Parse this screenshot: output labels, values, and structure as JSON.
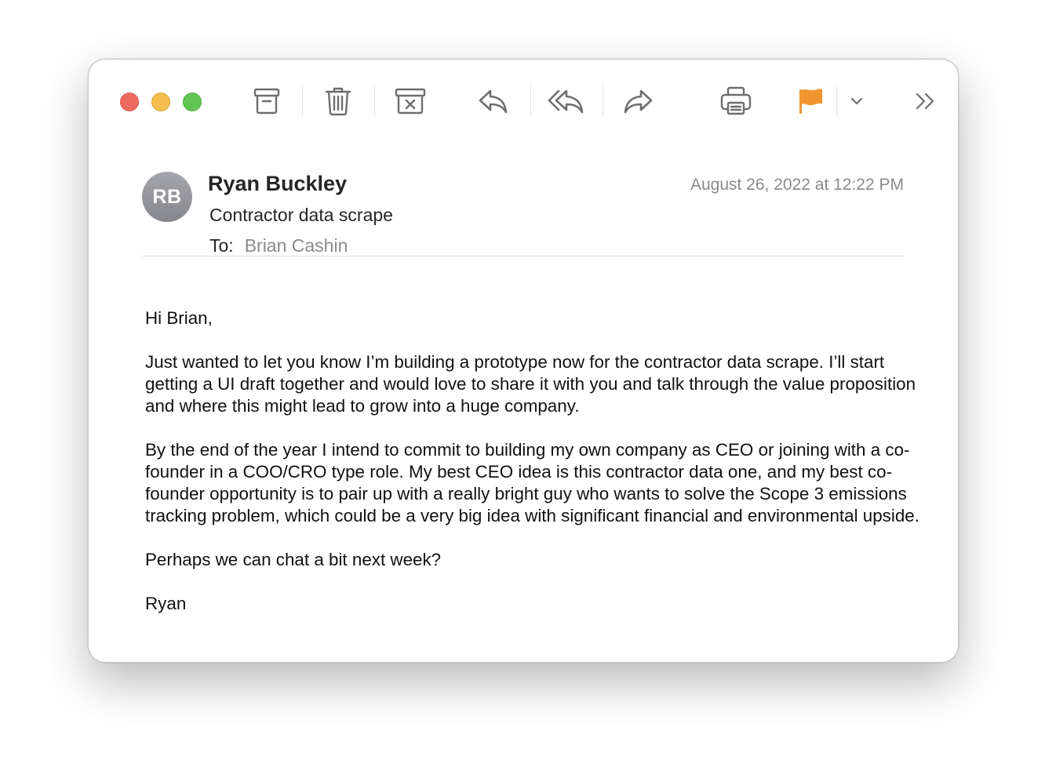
{
  "window": {
    "traffic_lights": [
      "close",
      "minimize",
      "zoom"
    ]
  },
  "toolbar": {
    "buttons": [
      {
        "icon": "archive-icon"
      },
      {
        "icon": "trash-icon"
      },
      {
        "icon": "junk-icon"
      },
      {
        "icon": "reply-icon"
      },
      {
        "icon": "reply-all-icon"
      },
      {
        "icon": "forward-icon"
      },
      {
        "icon": "print-icon"
      },
      {
        "icon": "flag-icon",
        "color": "#f0952f"
      },
      {
        "icon": "chevron-down-icon"
      },
      {
        "icon": "more-icon"
      }
    ]
  },
  "message": {
    "avatar_initials": "RB",
    "sender": "Ryan Buckley",
    "subject": "Contractor data scrape",
    "to_label": "To:",
    "to": "Brian Cashin",
    "date": "August 26, 2022 at 12:22 PM",
    "body": [
      "Hi Brian,",
      "Just wanted to let you know I’m building a prototype now for the contractor data scrape. I’ll start getting a UI draft together and would love to share it with you and talk through the value proposition and where this might lead to grow into a huge company.",
      "By the end of the year I intend to commit to building my own company as CEO or joining with a co-founder in a COO/CRO type role. My best CEO idea is this contractor data one, and my best co-founder opportunity is to pair up with a really bright guy who wants to solve the Scope 3 emissions tracking problem, which could be a very big idea with significant financial and environmental upside.",
      "Perhaps we can chat a bit next week?",
      "Ryan"
    ]
  },
  "colors": {
    "close": "#ec6a5e",
    "minimize": "#f4bf4f",
    "zoom": "#61c554",
    "flag": "#f0952f",
    "icon_gray": "#6e6e6e"
  }
}
